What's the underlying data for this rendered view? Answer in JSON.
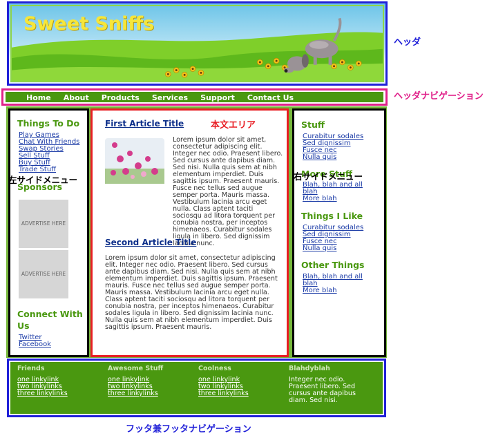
{
  "header": {
    "title": "Sweet Sniffs",
    "annotation": "ヘッダ"
  },
  "nav": {
    "items": [
      "Home",
      "About",
      "Products",
      "Services",
      "Support",
      "Contact Us"
    ],
    "annotation": "ヘッダナビゲーション"
  },
  "left_sidebar": {
    "things_heading": "Things To Do",
    "things_links": [
      "Play Games",
      "Chat With Friends",
      "Swap Stories",
      "Sell Stuff",
      "Buy Stuff",
      "Trade Stuff"
    ],
    "sponsors_heading": "Sponsors",
    "ad_text": "ADVERTISE HERE",
    "connect_heading": "Connect With Us",
    "connect_links": [
      "Twitter",
      "Facebook"
    ],
    "annotation": "左サイドメニュー"
  },
  "main": {
    "annotation": "本文エリア",
    "article1_title": "First Article Title",
    "article1_text": "Lorem ipsum dolor sit amet, consectetur adipiscing elit. Integer nec odio. Praesent libero. Sed cursus ante dapibus diam. Sed nisi. Nulla quis sem at nibh elementum imperdiet. Duis sagittis ipsum. Praesent mauris. Fusce nec tellus sed augue semper porta. Mauris massa. Vestibulum lacinia arcu eget nulla. Class aptent taciti sociosqu ad litora torquent per conubia nostra, per inceptos himenaeos. Curabitur sodales ligula in libero. Sed dignissim lacinia nunc.",
    "article2_title": "Second Article Title",
    "article2_text": "Lorem ipsum dolor sit amet, consectetur adipiscing elit. Integer nec odio. Praesent libero. Sed cursus ante dapibus diam. Sed nisi. Nulla quis sem at nibh elementum imperdiet. Duis sagittis ipsum. Praesent mauris. Fusce nec tellus sed augue semper porta. Mauris massa. Vestibulum lacinia arcu eget nulla. Class aptent taciti sociosqu ad litora torquent per conubia nostra, per inceptos himenaeos. Curabitur sodales ligula in libero. Sed dignissim lacinia nunc. Nulla quis sem at nibh elementum imperdiet. Duis sagittis ipsum. Praesent mauris."
  },
  "right_sidebar": {
    "annotation": "右サイドメニュー",
    "stuff_heading": "Stuff",
    "stuff_links": [
      "Curabitur sodales",
      "Sed dignissim",
      "Fusce nec",
      "Nulla quis"
    ],
    "more_heading": "More Stuff",
    "more_links": [
      "Blah, blah and all blah",
      "More blah"
    ],
    "like_heading": "Things I Like",
    "like_links": [
      "Curabitur sodales",
      "Sed dignissim",
      "Fusce nec",
      "Nulla quis"
    ],
    "other_heading": "Other Things",
    "other_links": [
      "Blah, blah and all blah",
      "More blah"
    ]
  },
  "footer": {
    "annotation": "フッタ兼フッタナビゲーション",
    "friends_heading": "Friends",
    "friends_links": [
      "one linkylink",
      "two linkylinks",
      "three linkylinks"
    ],
    "awesome_heading": "Awesome Stuff",
    "awesome_links": [
      "one linkylink",
      "two linkylinks",
      "three linkylinks"
    ],
    "coolness_heading": "Coolness",
    "coolness_links": [
      "one linkylink",
      "two linkylinks",
      "three linkylinks"
    ],
    "blah_heading": "Blahdyblah",
    "blah_text": "Integer nec odio. Praesent libero. Sed cursus ante dapibus diam. Sed nisi."
  },
  "colors": {
    "annotation_blue": "#2020d8",
    "annotation_pink": "#e0208a",
    "annotation_red": "#e81e24",
    "brand_green": "#4a9810",
    "title_yellow": "#f6e63a"
  }
}
